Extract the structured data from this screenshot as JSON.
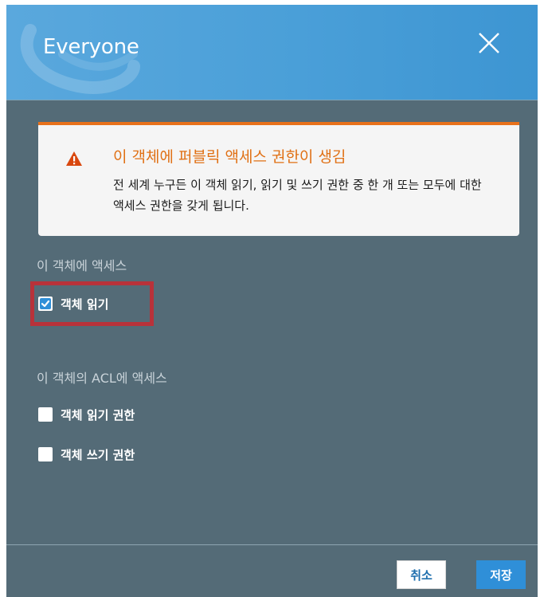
{
  "dialog": {
    "title": "Everyone",
    "close_icon": "close-icon"
  },
  "warning": {
    "icon": "warning-triangle-icon",
    "title": "이 객체에 퍼블릭 액세스 권한이 생김",
    "body": "전 세계 누구든 이 객체 읽기, 읽기 및 쓰기 권한 중 한 개 또는 모두에 대한 액세스 권한을 갖게 됩니다.",
    "accent_color": "#e8711b"
  },
  "object_access": {
    "label": "이 객체에 액세스",
    "options": [
      {
        "label": "객체 읽기",
        "checked": true
      }
    ]
  },
  "acl_access": {
    "label": "이 객체의 ACL에 액세스",
    "options": [
      {
        "label": "객체 읽기 권한",
        "checked": false
      },
      {
        "label": "객체 쓰기 권한",
        "checked": false
      }
    ]
  },
  "footer": {
    "cancel_label": "취소",
    "save_label": "저장"
  },
  "colors": {
    "header": "#4a9fd8",
    "body": "#546b77",
    "highlight": "#b8323a",
    "primary": "#2f8fd8"
  }
}
